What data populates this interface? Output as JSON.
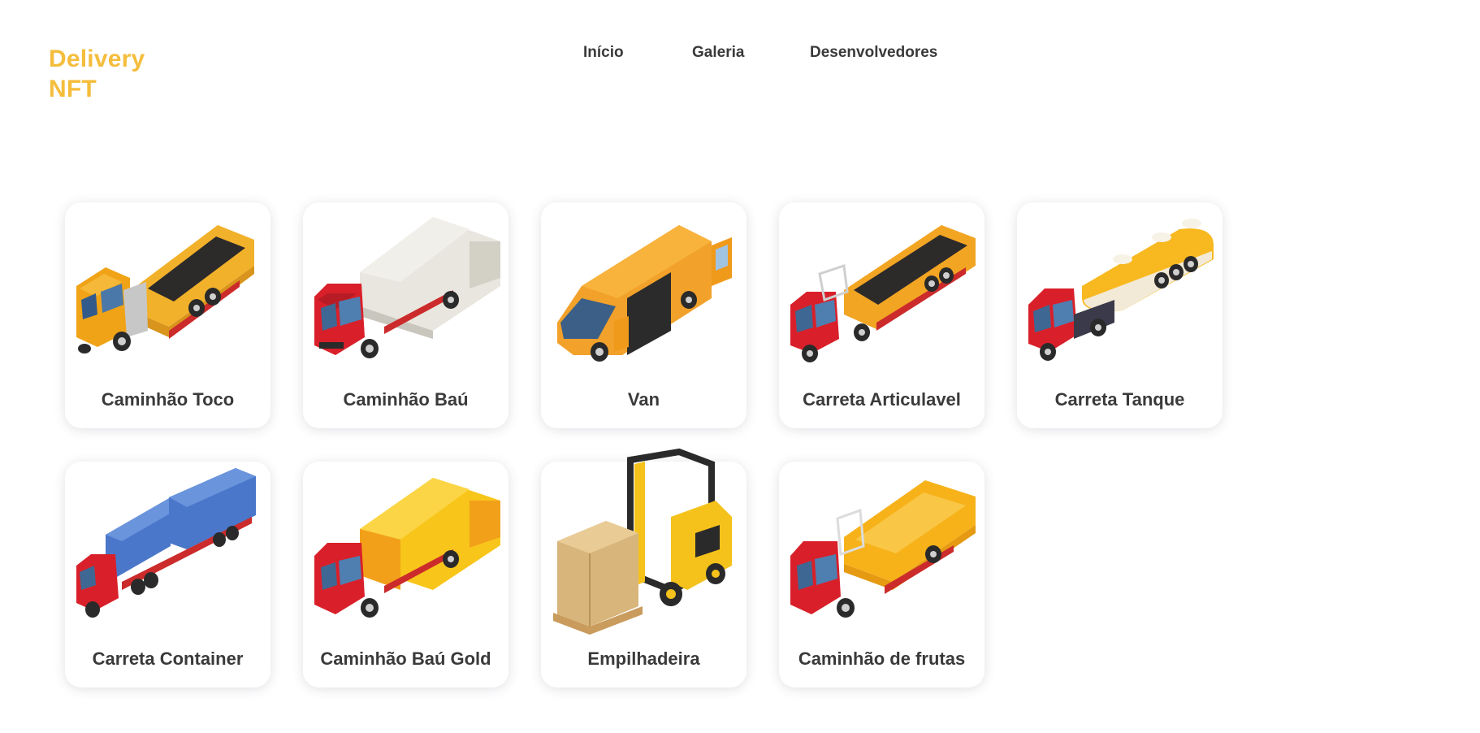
{
  "brand": {
    "line1": "Delivery",
    "line2": "NFT",
    "color": "#f4bd3c"
  },
  "nav": [
    {
      "label": "Início"
    },
    {
      "label": "Galeria"
    },
    {
      "label": "Desenvolvedores"
    }
  ],
  "cards": [
    {
      "title": "Caminhão Toco",
      "icon": "dump-truck-icon",
      "colors": {
        "cab": "#f0a316",
        "body": "#f2b12a"
      }
    },
    {
      "title": "Caminhão Baú",
      "icon": "box-truck-icon",
      "colors": {
        "cab": "#d9202a",
        "body": "#e8e6df"
      }
    },
    {
      "title": "Van",
      "icon": "van-icon",
      "colors": {
        "cab": "#f09a1c",
        "body": "#f2a12a"
      }
    },
    {
      "title": "Carreta Articulavel",
      "icon": "flatbed-trailer-icon",
      "colors": {
        "cab": "#d9202a",
        "body": "#f2a523"
      }
    },
    {
      "title": "Carreta Tanque",
      "icon": "tanker-truck-icon",
      "colors": {
        "cab": "#d9202a",
        "body": "#f8b81f"
      }
    },
    {
      "title": "Carreta Container",
      "icon": "container-truck-icon",
      "colors": {
        "cab": "#d9202a",
        "body": "#4a77c9"
      }
    },
    {
      "title": "Caminhão Baú Gold",
      "icon": "gold-box-truck-icon",
      "colors": {
        "cab": "#d9202a",
        "body": "#f8c51a"
      }
    },
    {
      "title": "Empilhadeira",
      "icon": "forklift-icon",
      "colors": {
        "cab": "#f4c21b",
        "body": "#d8b57a"
      }
    },
    {
      "title": "Caminhão de frutas",
      "icon": "fruit-truck-icon",
      "colors": {
        "cab": "#d9202a",
        "body": "#f7b21a"
      }
    }
  ]
}
